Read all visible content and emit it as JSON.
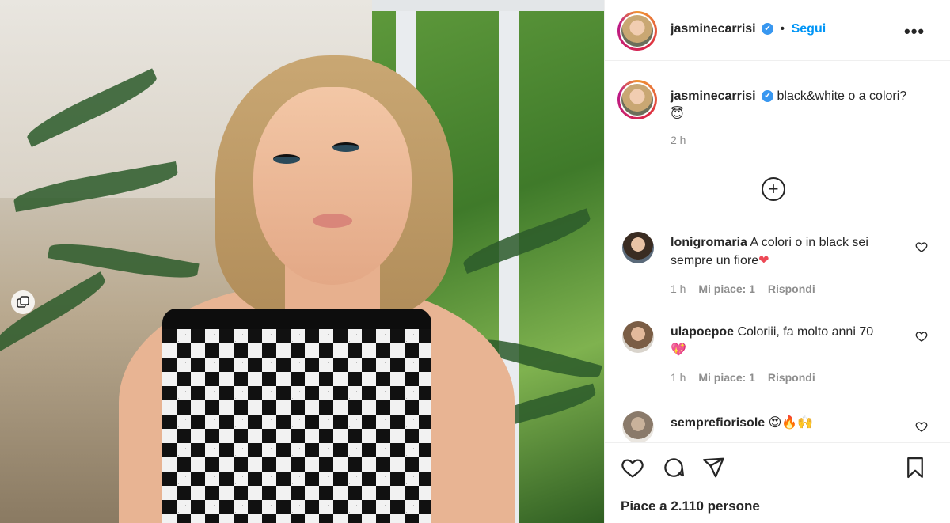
{
  "post": {
    "username": "jasminecarrisi",
    "verified_badge": "✔",
    "separator": "•",
    "follow_label": "Segui",
    "more_label": "•••",
    "caption_text": "black&white o a colori?",
    "caption_emoji": "😇",
    "caption_time": "2 h",
    "load_more_icon": "plus-circle-icon",
    "carousel_icon": "multi-photo-icon"
  },
  "comments": [
    {
      "username": "lonigromaria",
      "text": "A colori o in black sei sempre un fiore",
      "emoji": "❤",
      "time": "1 h",
      "likes": "Mi piace: 1",
      "reply": "Rispondi"
    },
    {
      "username": "ulapoepoe",
      "text": "Coloriii, fa molto anni 70",
      "emoji": "💖",
      "time": "1 h",
      "likes": "Mi piace: 1",
      "reply": "Rispondi"
    },
    {
      "username": "sempreforisole",
      "display": "semprefiorisole",
      "text": "",
      "emoji": "😍🔥🙌",
      "time": "",
      "likes": "",
      "reply": ""
    }
  ],
  "actions": {
    "like_icon": "heart-icon",
    "comment_icon": "comment-icon",
    "share_icon": "send-icon",
    "save_icon": "bookmark-icon",
    "likes_text": "Piace a 2.110 persone"
  },
  "colors": {
    "link_blue": "#0095f6",
    "verified_blue": "#3897f0",
    "heart_red": "#ed4956",
    "text_dark": "#262626",
    "text_grey": "#8e8e8e"
  }
}
